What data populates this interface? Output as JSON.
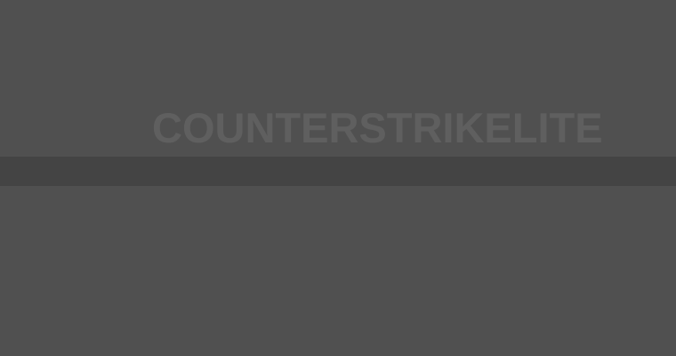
{
  "screen": {
    "title": "COUNTERSTRIKELITE"
  },
  "colors": {
    "background": "#505050",
    "title_text": "#5f5f5f",
    "band": "#444444"
  }
}
